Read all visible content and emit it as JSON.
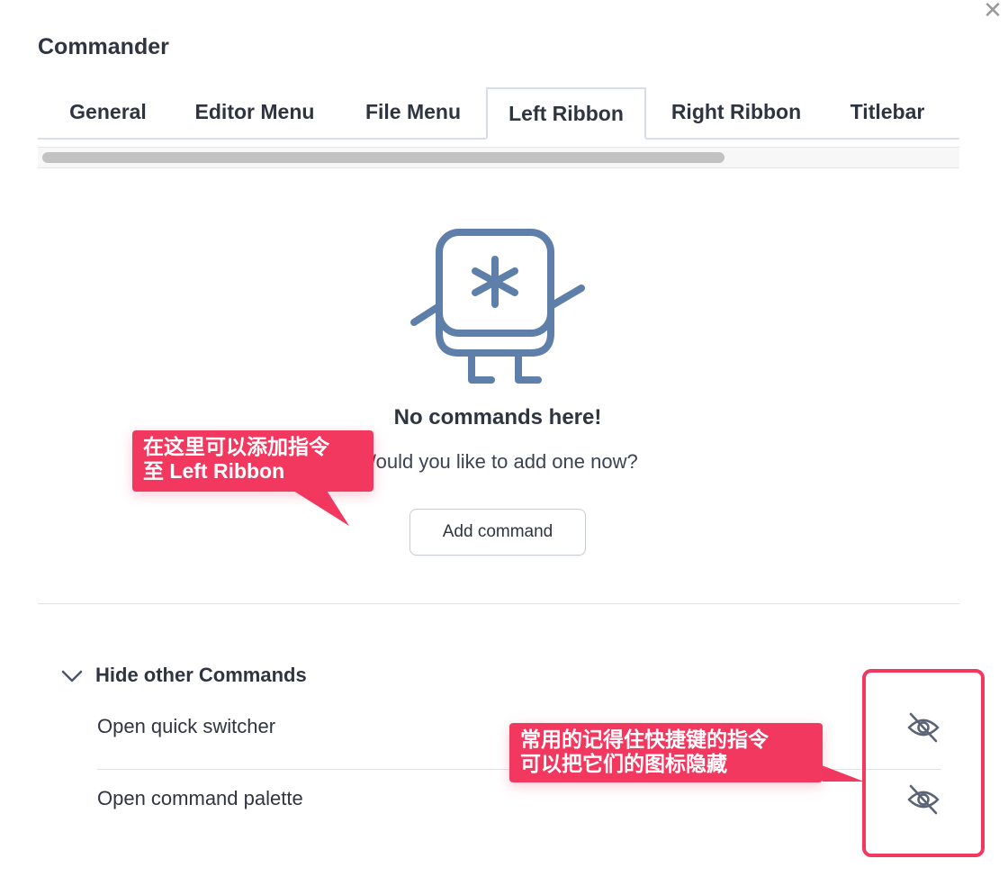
{
  "window": {
    "title": "Commander",
    "close_glyph": "✕"
  },
  "tabs": [
    {
      "label": "General"
    },
    {
      "label": "Editor Menu"
    },
    {
      "label": "File Menu"
    },
    {
      "label": "Left Ribbon"
    },
    {
      "label": "Right Ribbon"
    },
    {
      "label": "Titlebar"
    }
  ],
  "active_tab": "Left Ribbon",
  "empty_state": {
    "title": "No commands here!",
    "subtitle": "Would you like to add one now?",
    "add_button": "Add command",
    "mascot_icon": "asterisk-mascot-icon"
  },
  "hidden_section": {
    "title": "Hide other Commands",
    "items": [
      {
        "label": "Open quick switcher",
        "icon": "eye-off-icon"
      },
      {
        "label": "Open command palette",
        "icon": "eye-off-icon"
      }
    ]
  },
  "annotations": [
    {
      "lines": [
        "在这里可以添加指令",
        "至 Left Ribbon"
      ]
    },
    {
      "lines": [
        "常用的记得住快捷键的指令",
        "可以把它们的图标隐藏"
      ]
    }
  ],
  "colors": {
    "accent": "#f2385f",
    "mascot": "#5d7fa9",
    "text": "#2e3440"
  }
}
